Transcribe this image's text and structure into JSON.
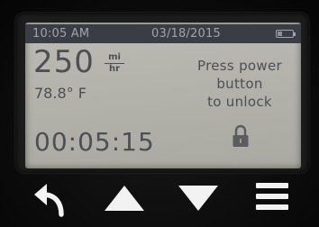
{
  "status_bar": {
    "time": "10:05 AM",
    "date": "03/18/2015",
    "battery_level": 0.25
  },
  "main": {
    "range_value": "250",
    "range_unit_top": "mi",
    "range_unit_bottom": "hr",
    "temperature": "78.8° F",
    "message_line1": "Press power",
    "message_line2": "button",
    "message_line3": "to unlock",
    "timer": "00:05:15",
    "lock_icon": "padlock-icon"
  },
  "buttons": [
    {
      "icon": "back-arrow-icon"
    },
    {
      "icon": "up-triangle-icon"
    },
    {
      "icon": "down-triangle-icon"
    },
    {
      "icon": "menu-icon"
    }
  ],
  "colors": {
    "lcd_background": "#b3b3ab",
    "lcd_text": "#4d4f52",
    "status_bar_bg": "#3a3d45",
    "button_icon": "#f2f2f2"
  }
}
